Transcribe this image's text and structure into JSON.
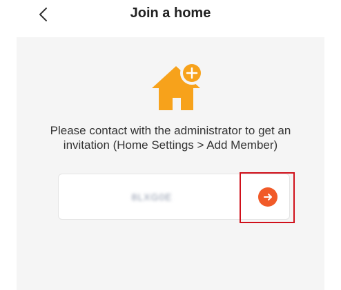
{
  "header": {
    "title": "Join a home",
    "back_icon": "chevron-left-icon"
  },
  "illustration": {
    "icon": "home-add-icon",
    "color": "#f7a21b"
  },
  "message": {
    "line1": "Please contact with the administrator to get an",
    "line2": "invitation (Home Settings > Add Member)"
  },
  "invitation": {
    "code_value": "8LXG0E",
    "submit_icon": "arrow-right-icon",
    "submit_color": "#f15a28",
    "highlight_color": "#d0101a"
  }
}
